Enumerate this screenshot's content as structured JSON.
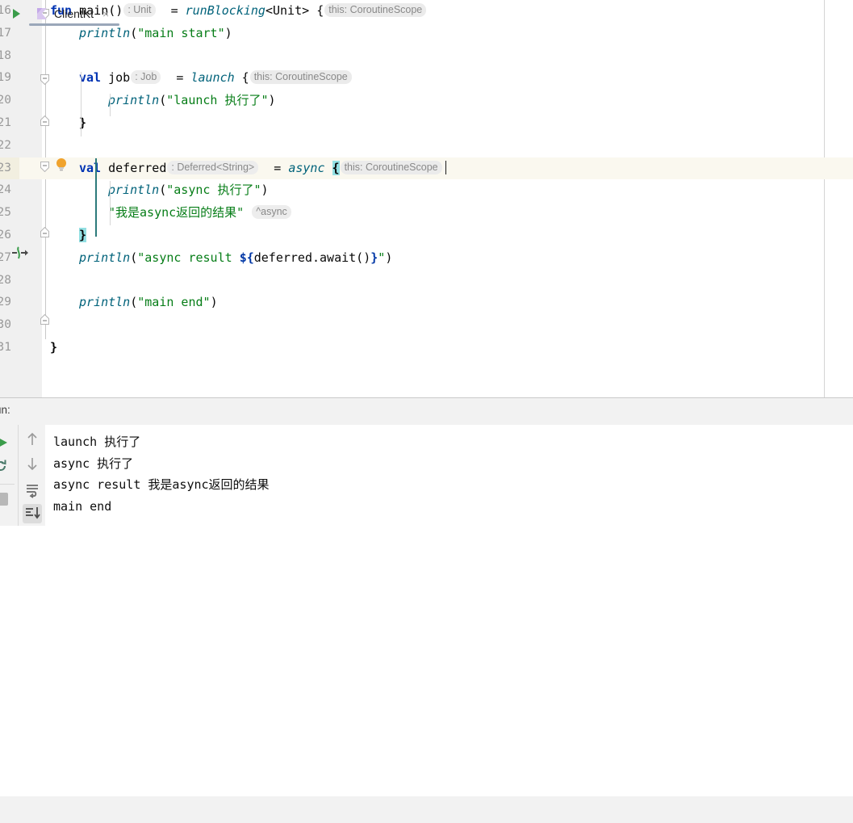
{
  "editor": {
    "language": "kotlin",
    "first_line_number": 16,
    "current_line_index": 7,
    "colors": {
      "keyword": "#0033b3",
      "string": "#067d17",
      "function": "#00627a",
      "inlay_hint_bg": "#ebebeb",
      "inlay_hint_text": "#898989",
      "current_line_bg": "#faf8ef",
      "brace_match_bg": "#93e0e3",
      "gutter_bg": "#f0f0f0",
      "run_arrow": "#3a9c4a",
      "bulb": "#f0a32d"
    },
    "lines": [
      {
        "num": "16",
        "text": "fun main() : Unit  = runBlocking<Unit> { this: CoroutineScope"
      },
      {
        "num": "17",
        "text": "    println(\"main start\")"
      },
      {
        "num": "18",
        "text": ""
      },
      {
        "num": "19",
        "text": "    val job : Job  = launch { this: CoroutineScope"
      },
      {
        "num": "20",
        "text": "        println(\"launch 执行了\")"
      },
      {
        "num": "21",
        "text": "    }"
      },
      {
        "num": "22",
        "text": ""
      },
      {
        "num": "23",
        "text": "    val deferred : Deferred<String>  = async { this: CoroutineScope"
      },
      {
        "num": "24",
        "text": "        println(\"async 执行了\")"
      },
      {
        "num": "25",
        "text": "        \"我是async返回的结果\" ^async"
      },
      {
        "num": "26",
        "text": "    }"
      },
      {
        "num": "27",
        "text": "    println(\"async result ${deferred.await()}\")"
      },
      {
        "num": "28",
        "text": ""
      },
      {
        "num": "29",
        "text": "    println(\"main end\")"
      },
      {
        "num": "30",
        "text": ""
      },
      {
        "num": "31",
        "text": "}"
      }
    ],
    "tokens": {
      "kw_fun": "fun",
      "kw_val": "val",
      "name_main": "main()",
      "name_job": "job",
      "name_deferred": "deferred",
      "eq": "=",
      "fn_runblocking": "runBlocking",
      "generic_unit": "<Unit>",
      "fn_launch": "launch",
      "fn_async": "async",
      "fn_println": "println",
      "brace_open": "{",
      "brace_close": "}",
      "paren_open": "(",
      "paren_close": ")",
      "str_main_start": "\"main start\"",
      "str_launch_zh": "\"launch 执行了\"",
      "str_async_zh": "\"async 执行了\"",
      "str_result_zh": "\"我是async返回的结果\"",
      "str_main_end": "\"main end\"",
      "str_async_result_prefix": "\"async result ",
      "tmpl_open": "${",
      "tmpl_expr": "deferred.await()",
      "tmpl_close": "}",
      "str_quote_end": "\""
    },
    "hints": {
      "unit": ": Unit",
      "job": ": Job",
      "deferred_string": ": Deferred<String>",
      "this_coroutinescope": "this: CoroutineScope",
      "caret_async": "^async"
    },
    "gutter_icons": {
      "run": "run-arrow-icon",
      "bulb": "intention-bulb-icon",
      "suspend_call": "suspend-call-icon",
      "fold": "fold-marker-icon"
    }
  },
  "run_panel": {
    "label": "un:",
    "tab": {
      "title": "ClientKt",
      "icon": "kotlin-file-icon",
      "close": "×"
    },
    "toolbar": {
      "rerun": "rerun-icon",
      "rerun_failed": "rerun-failed-icon",
      "stop": "stop-icon",
      "up": "prev-occurrence-icon",
      "down": "next-occurrence-icon",
      "soft_wrap": "soft-wrap-icon",
      "scroll_to_end": "scroll-to-end-icon"
    },
    "console_output": [
      "launch 执行了",
      "async 执行了",
      "async result 我是async返回的结果",
      "main end"
    ]
  }
}
